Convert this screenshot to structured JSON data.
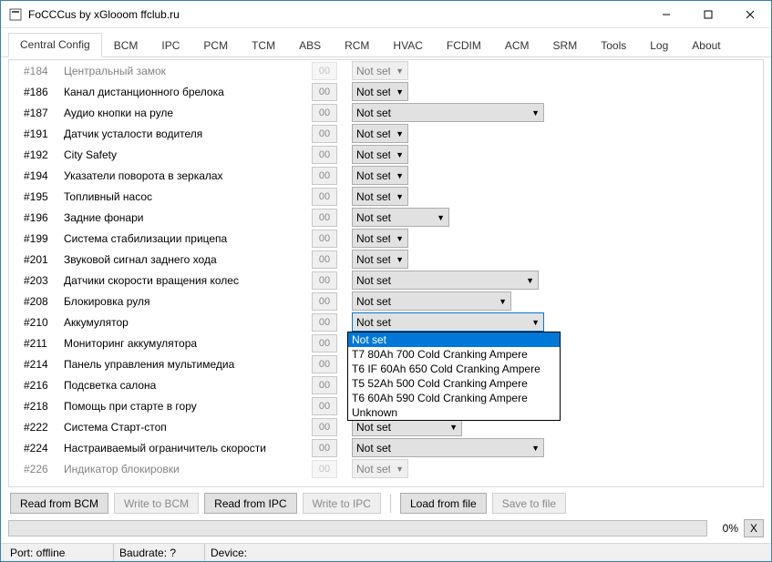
{
  "window": {
    "title": "FoCCCus by xGlooom ffclub.ru"
  },
  "tabs": [
    "Central Config",
    "BCM",
    "IPC",
    "PCM",
    "TCM",
    "ABS",
    "RCM",
    "HVAC",
    "FCDIM",
    "ACM",
    "SRM",
    "Tools",
    "Log",
    "About"
  ],
  "active_tab": 0,
  "hex_placeholder": "00",
  "combo_default": "Not set",
  "rows": [
    {
      "id": "#184",
      "label": "Центральный замок",
      "combo_w": 62,
      "partial": true
    },
    {
      "id": "#186",
      "label": "Канал дистанционного брелока",
      "combo_w": 62
    },
    {
      "id": "#187",
      "label": "Аудио кнопки на руле",
      "combo_w": 211
    },
    {
      "id": "#191",
      "label": "Датчик усталости водителя",
      "combo_w": 62
    },
    {
      "id": "#192",
      "label": "City Safety",
      "combo_w": 62
    },
    {
      "id": "#194",
      "label": "Указатели поворота в зеркалах",
      "combo_w": 62
    },
    {
      "id": "#195",
      "label": "Топливный насос",
      "combo_w": 62
    },
    {
      "id": "#196",
      "label": "Задние фонари",
      "combo_w": 107
    },
    {
      "id": "#199",
      "label": "Система стабилизации прицепа",
      "combo_w": 62
    },
    {
      "id": "#201",
      "label": "Звуковой сигнал заднего хода",
      "combo_w": 62
    },
    {
      "id": "#203",
      "label": "Датчики скорости вращения колес",
      "combo_w": 205
    },
    {
      "id": "#208",
      "label": "Блокировка руля",
      "combo_w": 175
    },
    {
      "id": "#210",
      "label": "Аккумулятор",
      "combo_w": 211,
      "open": true
    },
    {
      "id": "#211",
      "label": "Мониторинг аккумулятора",
      "combo_w": 62,
      "hidden": true
    },
    {
      "id": "#214",
      "label": "Панель управления мультимедиа",
      "combo_w": 62,
      "hidden": true
    },
    {
      "id": "#216",
      "label": "Подсветка салона",
      "combo_w": 62,
      "hidden": true
    },
    {
      "id": "#218",
      "label": "Помощь при старте в гору",
      "combo_w": 62,
      "hidden": true
    },
    {
      "id": "#222",
      "label": "Система Старт-стоп",
      "combo_w": 121
    },
    {
      "id": "#224",
      "label": "Настраиваемый ограничитель скорости",
      "combo_w": 211
    },
    {
      "id": "#226",
      "label": "Индикатор блокировки",
      "combo_w": 62,
      "partial": true
    }
  ],
  "dropdown": {
    "options": [
      "Not set",
      "T7 80Ah 700 Cold Cranking Ampere",
      "T6 IF 60Ah 650 Cold Cranking Ampere",
      "T5 52Ah 500 Cold Cranking Ampere",
      "T6 60Ah 590 Cold Cranking Ampere",
      "Unknown"
    ],
    "selected_index": 0
  },
  "buttons": {
    "read_bcm": "Read from BCM",
    "write_bcm": "Write to BCM",
    "read_ipc": "Read from IPC",
    "write_ipc": "Write to IPC",
    "load_file": "Load from file",
    "save_file": "Save to file"
  },
  "progress": {
    "pct": "0%",
    "x": "X"
  },
  "status": {
    "port": "Port: offline",
    "baud": "Baudrate: ?",
    "device": "Device:"
  }
}
